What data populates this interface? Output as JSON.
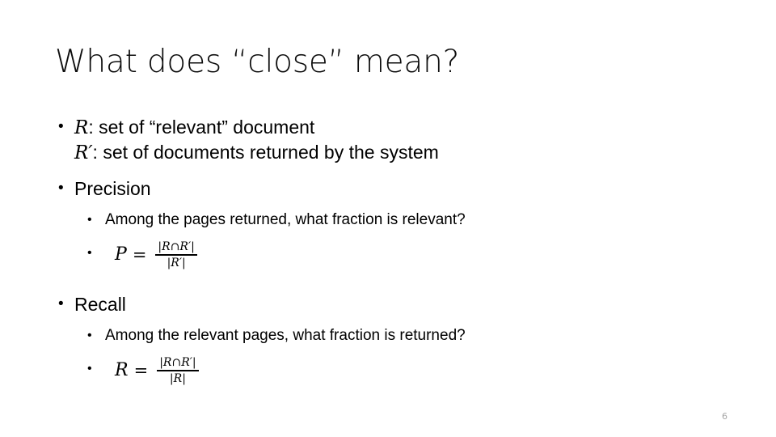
{
  "slide": {
    "title": "What does “close” mean?",
    "background_color": "#ffffff",
    "text_color": "#000000",
    "page_number": "6",
    "page_number_color": "#a6a6a6"
  },
  "bullets": {
    "b1_line1_var": "R",
    "b1_line1_text": ": set of “relevant” document",
    "b1_line2_var": "R′",
    "b1_line2_text": ": set of documents returned by the system",
    "b2_label": "Precision",
    "b2_sub1": "Among the pages returned, what fraction is relevant?",
    "b3_label": "Recall",
    "b3_sub1": "Among the relevant pages, what fraction is returned?"
  },
  "equations": {
    "precision": {
      "lhs": "P",
      "equals": "=",
      "numerator_open": "|",
      "numerator_var1": "R",
      "numerator_op": "∩",
      "numerator_var2": "R′",
      "numerator_close": "|",
      "denominator_open": "|",
      "denominator_var": "R′",
      "denominator_close": "|"
    },
    "recall": {
      "lhs": "R",
      "equals": "=",
      "numerator_open": "|",
      "numerator_var1": "R",
      "numerator_op": "∩",
      "numerator_var2": "R′",
      "numerator_close": "|",
      "denominator_open": "|",
      "denominator_var": "R",
      "denominator_close": "|"
    }
  },
  "icons": {
    "bullet_level1": "•",
    "bullet_level2": "•"
  }
}
